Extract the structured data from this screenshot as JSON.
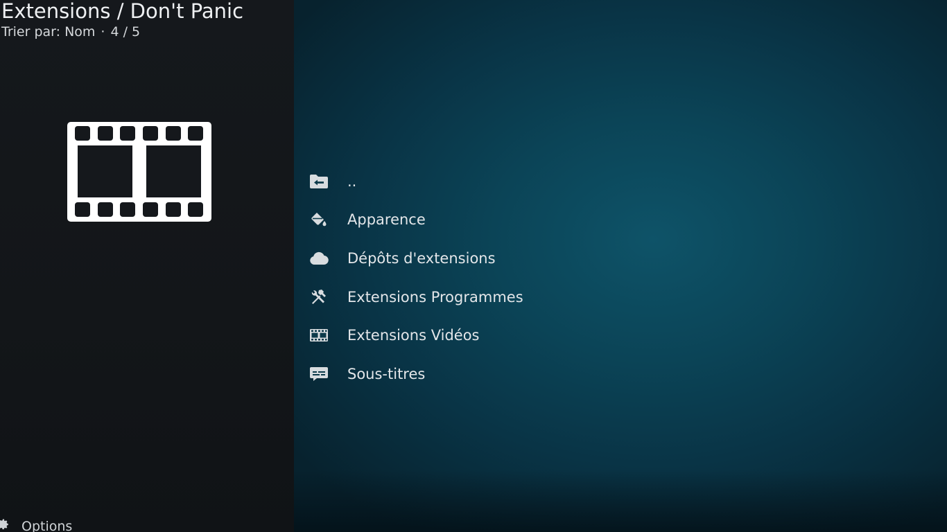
{
  "header": {
    "title": "Extensions / Don't Panic",
    "sort_text": "Trier par: Nom",
    "separator": "·",
    "position": "4 / 5"
  },
  "poster": {
    "icon": "film-strip-icon"
  },
  "list": {
    "items": [
      {
        "label": "..",
        "icon": "folder-back-icon"
      },
      {
        "label": "Apparence",
        "icon": "paint-bucket-icon"
      },
      {
        "label": "Dépôts d'extensions",
        "icon": "cloud-icon"
      },
      {
        "label": "Extensions Programmes",
        "icon": "tools-icon"
      },
      {
        "label": "Extensions Vidéos",
        "icon": "film-icon"
      },
      {
        "label": "Sous-titres",
        "icon": "subtitles-icon"
      }
    ]
  },
  "footer": {
    "options_label": "Options",
    "options_icon": "gear-icon"
  },
  "colors": {
    "accent_bg": "#0b4457",
    "sidebar_bg": "#14171b",
    "text": "#e3e6e9"
  }
}
